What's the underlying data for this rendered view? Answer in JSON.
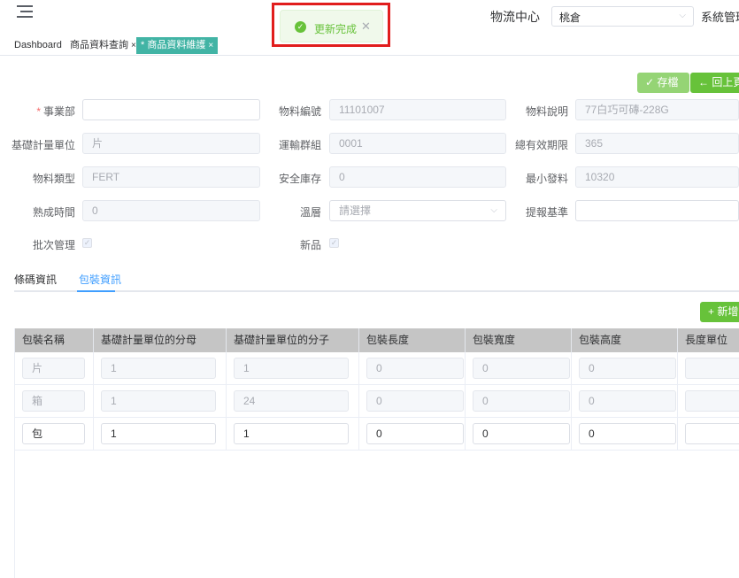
{
  "header": {
    "center_label": "物流中心",
    "warehouse_value": "桃倉",
    "system_menu": "系統管理"
  },
  "toast": {
    "message": "更新完成",
    "icon": "check-circle-icon",
    "close_icon": "close-icon",
    "color": "#67c23a"
  },
  "tags": [
    {
      "label": "Dashboard",
      "active": false
    },
    {
      "label": "商品資料查詢",
      "close": "×",
      "active": false
    },
    {
      "label": "* 商品資料維護",
      "close": "×",
      "active": true
    }
  ],
  "actions": {
    "save": "存檔",
    "back": "回上頁",
    "add": "新增"
  },
  "form": {
    "division": {
      "label": "事業部",
      "value": ""
    },
    "material_no": {
      "label": "物料編號",
      "value": "11101007"
    },
    "material_desc": {
      "label": "物料說明",
      "value": "77白巧可磚-228G"
    },
    "base_unit": {
      "label": "基礎計量單位",
      "value": "片"
    },
    "transport_group": {
      "label": "運輸群組",
      "value": "0001"
    },
    "total_shelf_life": {
      "label": "總有效期限",
      "value": "365"
    },
    "material_type": {
      "label": "物料類型",
      "value": "FERT"
    },
    "safety_stock": {
      "label": "安全庫存",
      "value": "0"
    },
    "min_issue": {
      "label": "最小發料",
      "value": "10320"
    },
    "ripening_time": {
      "label": "熟成時間",
      "value": "0"
    },
    "temperature_layer": {
      "label": "溫層",
      "placeholder": "請選擇"
    },
    "report_basis": {
      "label": "提報基準",
      "value": ""
    },
    "batch_mgmt": {
      "label": "批次管理",
      "checked": true
    },
    "new_product": {
      "label": "新品",
      "checked": true
    }
  },
  "tabs": [
    {
      "label": "條碼資訊",
      "active": false
    },
    {
      "label": "包裝資訊",
      "active": true
    }
  ],
  "table": {
    "columns": [
      "包裝名稱",
      "基礎計量單位的分母",
      "基礎計量單位的分子",
      "包裝長度",
      "包裝寬度",
      "包裝高度",
      "長度單位"
    ],
    "rows": [
      {
        "disabled": true,
        "cells": [
          "片",
          "1",
          "1",
          "0",
          "0",
          "0",
          ""
        ]
      },
      {
        "disabled": true,
        "cells": [
          "箱",
          "1",
          "24",
          "0",
          "0",
          "0",
          ""
        ]
      },
      {
        "disabled": false,
        "cells": [
          "包",
          "1",
          "1",
          "0",
          "0",
          "0",
          ""
        ]
      }
    ]
  },
  "colors": {
    "accent": "#409eff",
    "success": "#67c23a",
    "tag_active": "#42b4a5",
    "table_header": "#c5c5c5",
    "highlight": "#e11d1d"
  }
}
